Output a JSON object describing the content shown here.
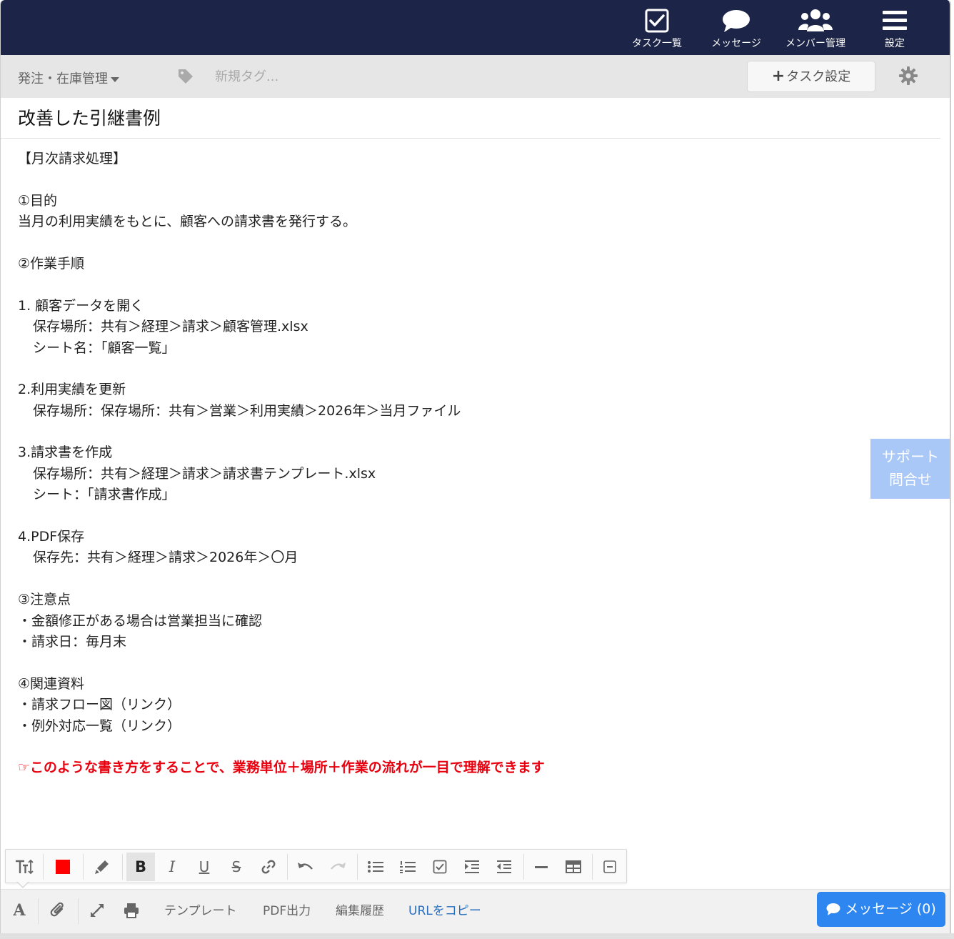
{
  "nav": {
    "tasks_label": "タスク一覧",
    "messages_label": "メッセージ",
    "members_label": "メンバー管理",
    "settings_label": "設定"
  },
  "subbar": {
    "category": "発注・在庫管理",
    "tag_placeholder": "新規タグ...",
    "task_setting_label": "タスク設定"
  },
  "document": {
    "title": "改善した引継書例",
    "lines": [
      {
        "text": "【月次請求処理】",
        "indent": false
      },
      {
        "text": "",
        "indent": false
      },
      {
        "text": "①目的",
        "indent": false
      },
      {
        "text": "当月の利用実績をもとに、顧客への請求書を発行する。",
        "indent": false
      },
      {
        "text": "",
        "indent": false
      },
      {
        "text": "②作業手順",
        "indent": false
      },
      {
        "text": "",
        "indent": false
      },
      {
        "text": "1. 顧客データを開く",
        "indent": false
      },
      {
        "text": "保存場所：共有＞経理＞請求＞顧客管理.xlsx",
        "indent": true
      },
      {
        "text": "シート名：「顧客一覧」",
        "indent": true
      },
      {
        "text": "",
        "indent": false
      },
      {
        "text": "2.利用実績を更新",
        "indent": false
      },
      {
        "text": "保存場所：保存場所：共有＞営業＞利用実績＞2026年＞当月ファイル",
        "indent": true
      },
      {
        "text": "",
        "indent": false
      },
      {
        "text": "3.請求書を作成",
        "indent": false
      },
      {
        "text": "保存場所：共有＞経理＞請求＞請求書テンプレート.xlsx",
        "indent": true
      },
      {
        "text": "シート：「請求書作成」",
        "indent": true
      },
      {
        "text": "",
        "indent": false
      },
      {
        "text": "4.PDF保存",
        "indent": false
      },
      {
        "text": "保存先：共有＞経理＞請求＞2026年＞〇月",
        "indent": true
      },
      {
        "text": "",
        "indent": false
      },
      {
        "text": "③注意点",
        "indent": false
      },
      {
        "text": "・金額修正がある場合は営業担当に確認",
        "indent": false
      },
      {
        "text": "・請求日：毎月末",
        "indent": false
      },
      {
        "text": "",
        "indent": false
      },
      {
        "text": "④関連資料",
        "indent": false
      },
      {
        "text": "・請求フロー図（リンク）",
        "indent": false
      },
      {
        "text": "・例外対応一覧（リンク）",
        "indent": false
      },
      {
        "text": "",
        "indent": false
      }
    ],
    "note_symbol": "☞",
    "note_text": "このような書き方をすることで、業務単位＋場所＋作業の流れが一目で理解できます"
  },
  "support": {
    "line1": "サポート",
    "line2": "問合せ"
  },
  "bottom": {
    "template_label": "テンプレート",
    "pdf_label": "PDF出力",
    "history_label": "編集履歴",
    "copy_url_label": "URLをコピー",
    "message_button": "メッセージ (0)"
  },
  "colors": {
    "topbar": "#1c2547",
    "note_red": "#e8000f",
    "font_color_swatch": "#ff0000",
    "message_button": "#2e86f0",
    "support_button": "#a9c8f7"
  }
}
